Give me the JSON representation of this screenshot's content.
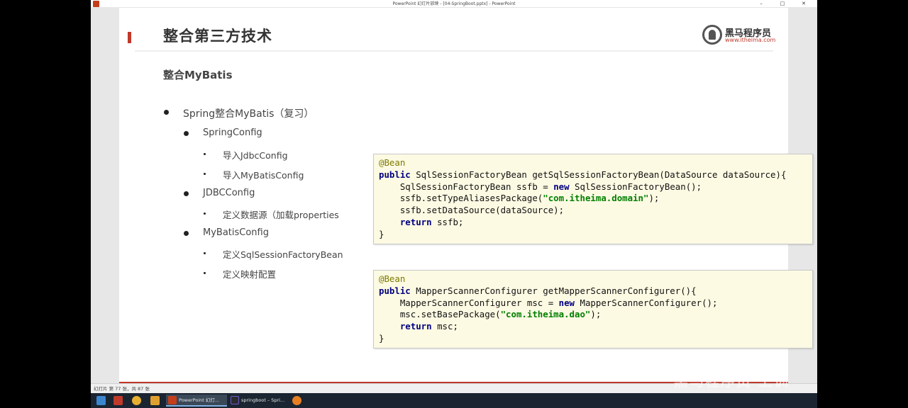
{
  "window": {
    "title": "PowerPoint 幻灯片放映 - [04-SpringBoot.pptx] - PowerPoint",
    "controls": [
      "–",
      "□",
      "✕"
    ]
  },
  "slide": {
    "title": "整合第三方技术",
    "subtitle": "整合MyBatis",
    "logo_name": "黑马程序员",
    "logo_url": "www.itheima.com",
    "bullets": [
      {
        "level": 1,
        "text": "Spring整合MyBatis（复习）"
      },
      {
        "level": 2,
        "text": "SpringConfig"
      },
      {
        "level": 3,
        "text": "导入JdbcConfig"
      },
      {
        "level": 3,
        "text": "导入MyBatisConfig"
      },
      {
        "level": 2,
        "text": "JDBCConfig"
      },
      {
        "level": 3,
        "text": "定义数据源（加载properties"
      },
      {
        "level": 2,
        "text": "MyBatisConfig"
      },
      {
        "level": 3,
        "text": "定义SqlSessionFactoryBean"
      },
      {
        "level": 3,
        "text": "定义映射配置"
      }
    ],
    "code1": {
      "l1": "@Bean",
      "l2a": "public",
      "l2b": " SqlSessionFactoryBean getSqlSessionFactoryBean(DataSource dataSource){",
      "l3a": "    SqlSessionFactoryBean ssfb = ",
      "l3b": "new",
      "l3c": " SqlSessionFactoryBean();",
      "l4a": "    ssfb.setTypeAliasesPackage(",
      "l4b": "\"com.itheima.domain\"",
      "l4c": ");",
      "l5": "    ssfb.setDataSource(dataSource);",
      "l6a": "    ",
      "l6b": "return",
      "l6c": " ssfb;",
      "l7": "}"
    },
    "code2": {
      "l1": "@Bean",
      "l2a": "public",
      "l2b": " MapperScannerConfigurer getMapperScannerConfigurer(){",
      "l3a": "    MapperScannerConfigurer msc = ",
      "l3b": "new",
      "l3c": " MapperScannerConfigurer();",
      "l4a": "    msc.setBasePackage(",
      "l4b": "\"com.itheima.dao\"",
      "l4c": ");",
      "l5a": "    ",
      "l5b": "return",
      "l5c": " msc;",
      "l6": "}"
    }
  },
  "statusbar": {
    "text": "幻灯片 第 77 张，共 87 张"
  },
  "taskbar": {
    "tasks": [
      {
        "label": "PowerPoint 幻灯...",
        "active": true
      },
      {
        "label": "springboot – Spri...",
        "active": false
      }
    ]
  },
  "watermark": "黑马程序员 上训"
}
